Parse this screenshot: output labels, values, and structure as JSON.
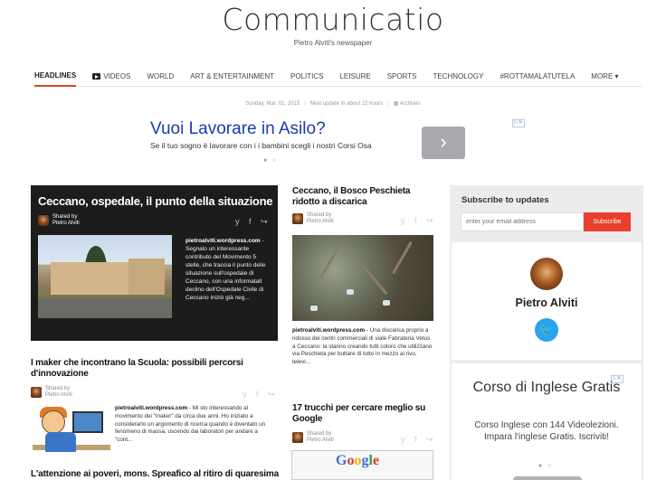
{
  "site": {
    "title": "Communicatio",
    "subtitle": "Pietro Alviti's newspaper"
  },
  "nav": {
    "items": [
      {
        "label": "HEADLINES",
        "active": true
      },
      {
        "label": "VIDEOS",
        "icon": "video-icon"
      },
      {
        "label": "WORLD"
      },
      {
        "label": "ART & ENTERTAINMENT"
      },
      {
        "label": "POLITICS"
      },
      {
        "label": "LEISURE"
      },
      {
        "label": "SPORTS"
      },
      {
        "label": "TECHNOLOGY"
      },
      {
        "label": "#ROTTAMALATUTELA"
      }
    ],
    "more": "MORE ▾"
  },
  "dateline": {
    "date": "Sunday, Mar. 01, 2015",
    "next_update": "Next update in about 22 hours",
    "archives": "Archives"
  },
  "ad_top": {
    "title": "Vuoi Lavorare in Asilo?",
    "desc": "Se il tuo sogno è lavorare con i i bambini scegli i nostri Corsi Osa",
    "button": "›",
    "choices": "▷✕",
    "dots": "● ○"
  },
  "featured": {
    "title": "Ceccano, ospedale, il punto della situazione",
    "shared_by": "Shared by",
    "author": "Pietro Alviti",
    "share": "y f ↪",
    "source": "pietroalviti.wordpress.com",
    "desc": " - Segnalo un interessante contributo del Movimento 5 stelle, che traccia il punto delle situazione sull'ospedale di Ceccano, con una informatall declino dell'Ospedale Civile di Ceccano iniziò già neg..."
  },
  "article2": {
    "title": "I maker che incontrano la Scuola: possibili percorsi d'innovazione",
    "shared_by": "Shared by",
    "author": "Pietro Alviti",
    "share": "y f ↪",
    "source": "pietroalviti.wordpress.com",
    "desc": " - Mi sto interessando al movimento dei \"maker\" da circa due anni. Ho iniziato a considerarlo un argomento di ricerca quando è diventato un fenomeno di massa, uscendo dai laboratori per andare a \"cont..."
  },
  "article3": {
    "title": "L'attenzione ai poveri, mons. Spreafico al ritiro di quaresima"
  },
  "col2_a": {
    "title": "Ceccano, il Bosco Peschieta ridotto a discarica",
    "shared_by": "Shared by",
    "author": "Pietro Alviti",
    "share": "y f ↪",
    "source": "pietroalviti.wordpress.com",
    "desc": " - Una discarica proprio a ridosso dei centri commerciali di viale Fabrateria Vetus a Ceccano: la stanno creando tutti coloro che utilizzano via Peschieta per buttare di tutto in mezzo ai rivo, televi..."
  },
  "col2_b": {
    "title": "17 trucchi per cercare meglio su Google",
    "shared_by": "Shared by",
    "author": "Pietro Alviti",
    "share": "y f ↪",
    "image_text": "Google"
  },
  "sidebar": {
    "subscribe_title": "Subscribe to updates",
    "email_placeholder": "enter your email address",
    "subscribe_button": "Subscribe",
    "profile_name": "Pietro Alviti",
    "twitter": "🐦"
  },
  "ad_side": {
    "title": "Corso di Inglese Gratis",
    "desc": "Corso Inglese con 144 Videolezioni. Impara l'inglese Gratis. Iscriviti!",
    "choices": "▷✕",
    "dots": "● ○"
  }
}
